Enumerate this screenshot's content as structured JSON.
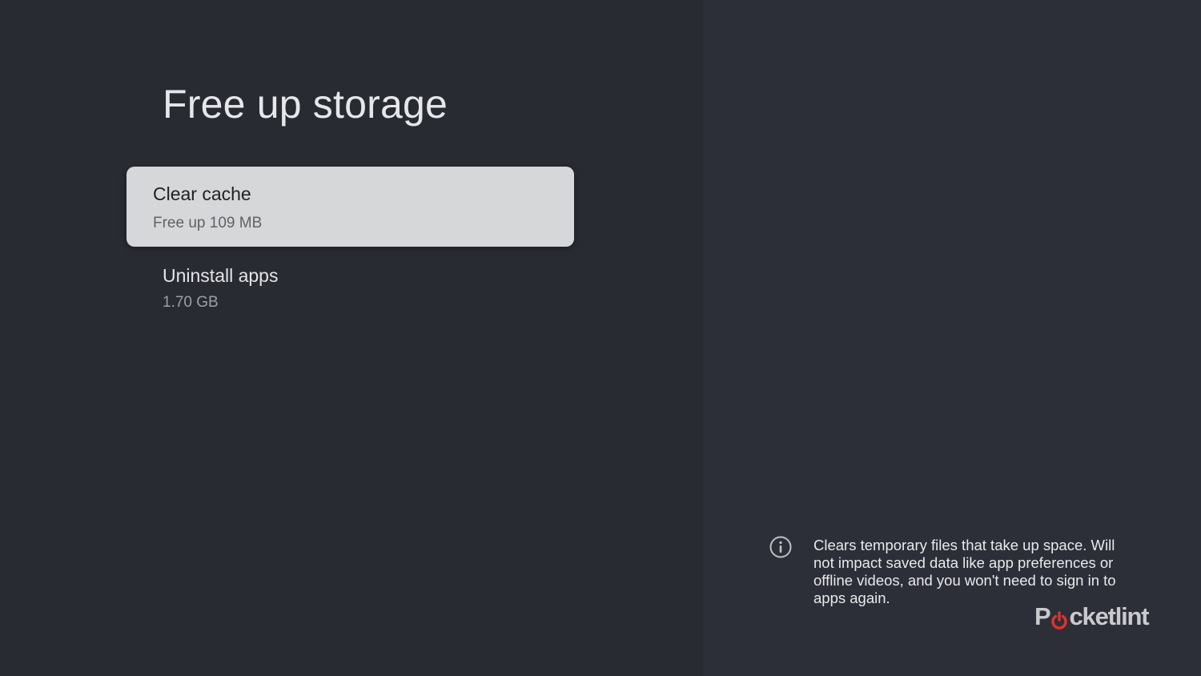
{
  "page": {
    "title": "Free up storage"
  },
  "options": [
    {
      "title": "Clear cache",
      "subtitle": "Free up 109 MB",
      "focused": true
    },
    {
      "title": "Uninstall apps",
      "subtitle": "1.70 GB",
      "focused": false
    }
  ],
  "info": {
    "icon": "info-icon",
    "text": "Clears temporary files that take up space. Will not impact saved data like app preferences or offline videos, and you won't need to sign in to apps again."
  },
  "watermark": {
    "logo_text": "Pocket-lint",
    "prefix": "P",
    "suffix": "cketlint",
    "accent_color": "#e0322e"
  },
  "colors": {
    "background": "#292b33",
    "panel": "#2d2f38",
    "focus_card": "#d6d7d9"
  }
}
